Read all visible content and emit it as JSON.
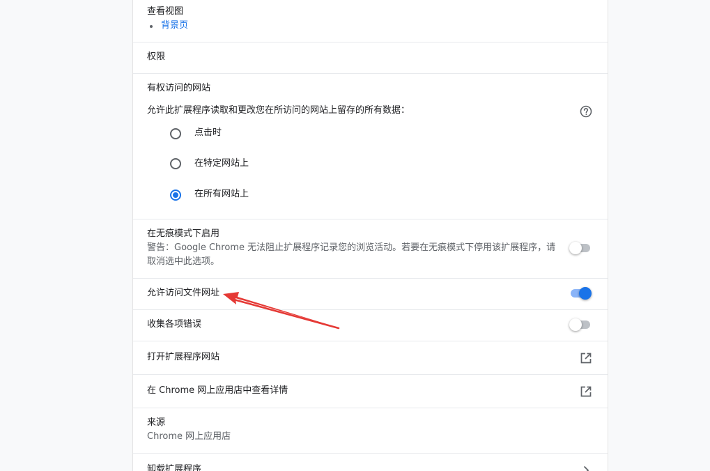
{
  "view": {
    "heading": "查看视图",
    "items": [
      "背景页"
    ]
  },
  "permissions": {
    "heading": "权限"
  },
  "site_access": {
    "heading": "有权访问的网站",
    "description": "允许此扩展程序读取和更改您在所访问的网站上留存的所有数据：",
    "options": [
      {
        "label": "点击时",
        "selected": false
      },
      {
        "label": "在特定网站上",
        "selected": false
      },
      {
        "label": "在所有网站上",
        "selected": true
      }
    ]
  },
  "incognito": {
    "heading": "在无痕模式下启用",
    "warning_line1": "警告：Google Chrome 无法阻止扩展程序记录您的浏览活动。若要在无痕模式下停用该扩展程序，请",
    "warning_line2": "取消选中此选项。",
    "enabled": false
  },
  "file_urls": {
    "label": "允许访问文件网址",
    "enabled": true
  },
  "collect_errors": {
    "label": "收集各项错误",
    "enabled": false
  },
  "open_site": {
    "label": "打开扩展程序网站"
  },
  "store_details": {
    "label": "在 Chrome 网上应用店中查看详情"
  },
  "source": {
    "heading": "来源",
    "value": "Chrome 网上应用店"
  },
  "uninstall": {
    "label": "卸载扩展程序"
  },
  "colors": {
    "accent": "#1a73e8",
    "annotation_arrow": "#e53935"
  }
}
